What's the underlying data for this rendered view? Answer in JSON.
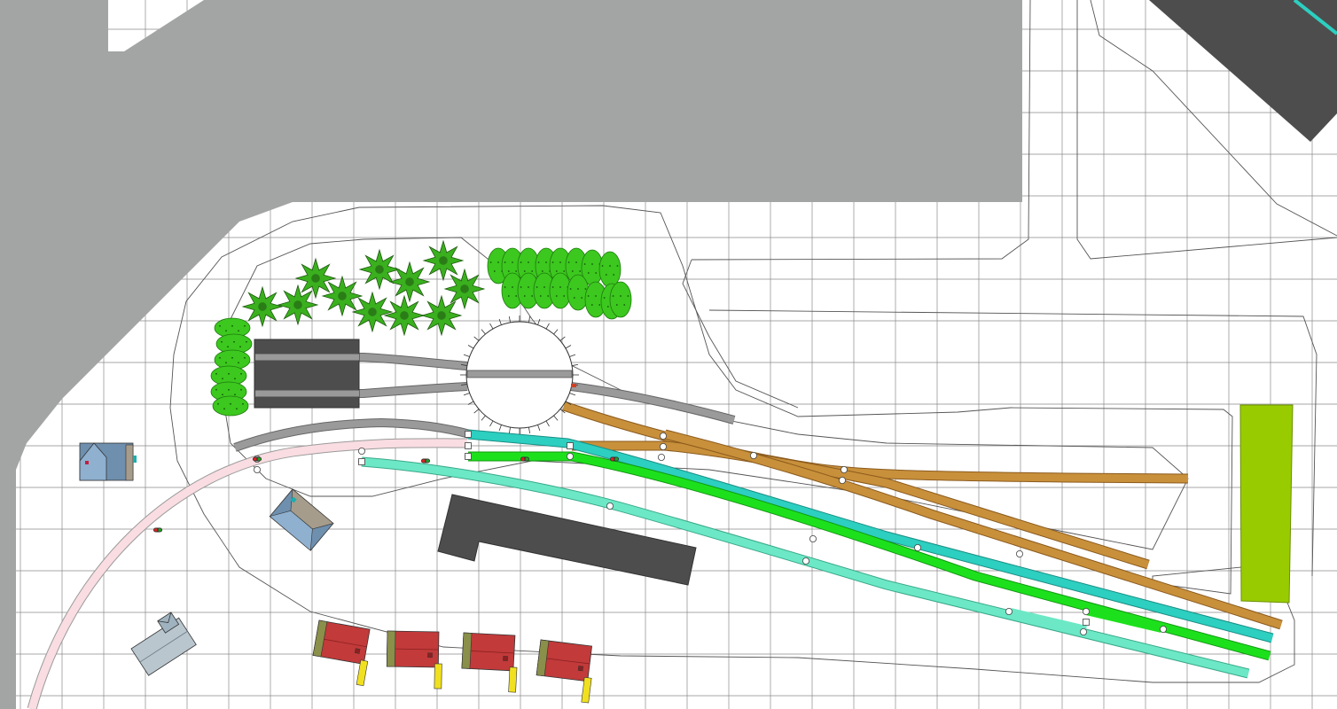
{
  "app": {
    "view": "track-plan-canvas"
  },
  "colors": {
    "background": "#ffffff",
    "grid": "#8a8a8a",
    "wall_area": "#a3a5a4",
    "baseboard_outline": "#555555",
    "dark_structure": "#4d4d4d",
    "track_grey": "#9a9a9a",
    "track_orange": "#c8903a",
    "track_cyan": "#2ccfc0",
    "track_green": "#1de01d",
    "track_mint": "#6ce8c6",
    "track_pink": "#f9dde2",
    "platform_lime": "#99cc00",
    "tree_dark": "#2e8b1e",
    "bush_light": "#3cc81e",
    "house_blue": "#6f8fae",
    "house_red": "#c23a3a",
    "signal_red": "#e02020",
    "signal_green": "#20a020"
  },
  "layers": [
    {
      "name": "grid"
    },
    {
      "name": "room-walls"
    },
    {
      "name": "baseboard"
    },
    {
      "name": "tracks"
    },
    {
      "name": "turntable"
    },
    {
      "name": "structures"
    },
    {
      "name": "scenery"
    }
  ],
  "tracks": [
    {
      "id": "roundhouse-spur-upper",
      "color": "track_grey"
    },
    {
      "id": "roundhouse-spur-lower",
      "color": "track_grey"
    },
    {
      "id": "turntable-exit",
      "color": "track_grey"
    },
    {
      "id": "headshunt",
      "color": "track_grey"
    },
    {
      "id": "siding-orange-upper",
      "color": "track_orange"
    },
    {
      "id": "siding-orange-lower",
      "color": "track_orange"
    },
    {
      "id": "main-cyan",
      "color": "track_cyan"
    },
    {
      "id": "main-green",
      "color": "track_green"
    },
    {
      "id": "main-mint",
      "color": "track_mint"
    },
    {
      "id": "curve-pink",
      "color": "track_pink"
    }
  ],
  "structures": [
    {
      "id": "engine-shed"
    },
    {
      "id": "goods-shed"
    },
    {
      "id": "turntable"
    },
    {
      "id": "station-platform"
    },
    {
      "id": "house-blue-1"
    },
    {
      "id": "house-blue-2"
    },
    {
      "id": "house-grey"
    },
    {
      "id": "house-red-1"
    },
    {
      "id": "house-red-2"
    },
    {
      "id": "house-red-3"
    },
    {
      "id": "house-red-4"
    }
  ]
}
